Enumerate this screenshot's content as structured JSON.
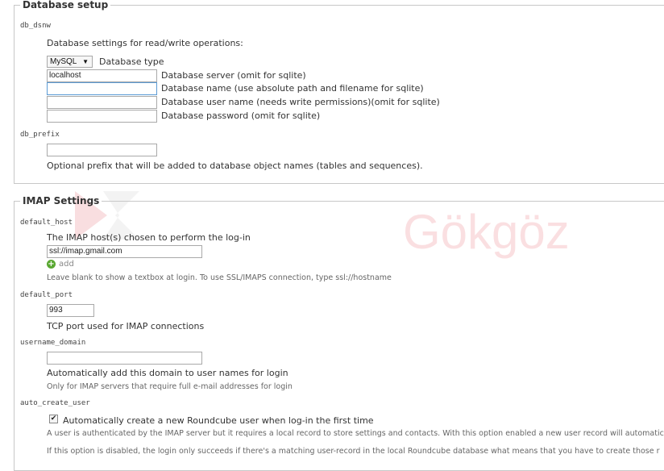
{
  "database_setup": {
    "legend": "Database setup",
    "db_dsnw": {
      "label": "db_dsnw",
      "description": "Database settings for read/write operations:",
      "type_select": {
        "value": "MySQL",
        "label": "Database type"
      },
      "fields": [
        {
          "value": "localhost",
          "label": "Database server (omit for sqlite)"
        },
        {
          "value": "",
          "label": "Database name (use absolute path and filename for sqlite)"
        },
        {
          "value": "",
          "label": "Database user name (needs write permissions)(omit for sqlite)"
        },
        {
          "value": "",
          "label": "Database password (omit for sqlite)"
        }
      ]
    },
    "db_prefix": {
      "label": "db_prefix",
      "value": "",
      "description": "Optional prefix that will be added to database object names (tables and sequences)."
    }
  },
  "imap_settings": {
    "legend": "IMAP Settings",
    "default_host": {
      "label": "default_host",
      "description": "The IMAP host(s) chosen to perform the log-in",
      "value": "ssl://imap.gmail.com",
      "add_label": "add",
      "hint": "Leave blank to show a textbox at login. To use SSL/IMAPS connection, type ssl://hostname"
    },
    "default_port": {
      "label": "default_port",
      "value": "993",
      "description": "TCP port used for IMAP connections"
    },
    "username_domain": {
      "label": "username_domain",
      "value": "",
      "description": "Automatically add this domain to user names for login",
      "hint": "Only for IMAP servers that require full e-mail addresses for login"
    },
    "auto_create_user": {
      "label": "auto_create_user",
      "checked_mark": "✔",
      "checkbox_label": "Automatically create a new Roundcube user when log-in the first time",
      "hint1": "A user is authenticated by the IMAP server but it requires a local record to store settings and contacts. With this option enabled a new user record will automatic",
      "hint2": "If this option is disabled, the login only succeeds if there's a matching user-record in the local Roundcube database what means that you have to create those r"
    }
  },
  "watermark": {
    "text": "Gökgöz",
    "color": "#e2505a"
  }
}
